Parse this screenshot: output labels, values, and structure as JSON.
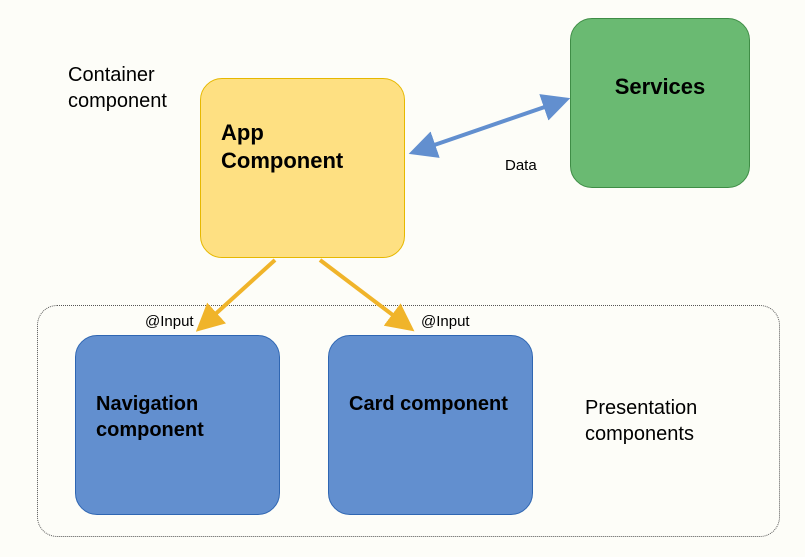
{
  "labels": {
    "container": "Container component",
    "presentation": "Presentation components",
    "data": "Data",
    "input1": "@Input",
    "input2": "@Input"
  },
  "boxes": {
    "app": "App Component",
    "services": "Services",
    "navigation": "Navigation component",
    "card": "Card component"
  },
  "arrows": {
    "dataArrow": {
      "from": "app",
      "to": "services",
      "bidirectional": true,
      "color": "#628fcf"
    },
    "toNavigation": {
      "from": "app",
      "to": "navigation",
      "color": "#f0b42a"
    },
    "toCard": {
      "from": "app",
      "to": "card",
      "color": "#f0b42a"
    }
  }
}
